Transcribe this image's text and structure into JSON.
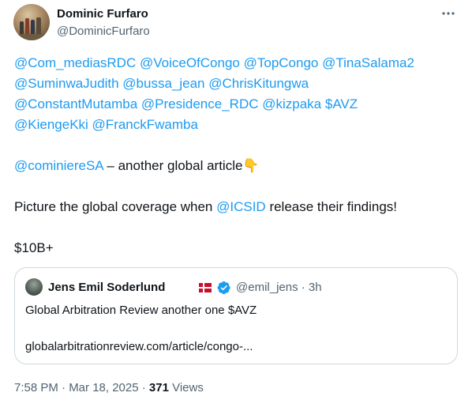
{
  "author": {
    "name": "Dominic Furfaro",
    "handle": "@DominicFurfaro",
    "avatar_icon": "profile-photo"
  },
  "more_icon": "ellipsis-icon",
  "tweet": {
    "mentions_line1": [
      "@Com_mediasRDC",
      "@VoiceOfCongo",
      "@TopCongo",
      "@TinaSalama2"
    ],
    "mentions_line2": [
      "@SuminwaJudith",
      "@bussa_jean",
      "@ChrisKitungwa"
    ],
    "mentions_line3": [
      "@ConstantMutamba",
      "@Presidence_RDC",
      "@kizpaka",
      "$AVZ"
    ],
    "mentions_line4": [
      "@KiengeKki",
      "@FranckFwamba"
    ],
    "line5_mention": "@cominiereSA",
    "line5_text": " – another global article👇",
    "line6_before": "Picture the global coverage when ",
    "line6_mention": "@ICSID",
    "line6_after": " release their findings!",
    "line7": "$10B+"
  },
  "quote": {
    "name": "Jens Emil Soderlund",
    "flag": "Denmark flag",
    "handle_time": "@emil_jens · 3h",
    "text": "Global Arbitration Review another one $AVZ",
    "link": "globalarbitrationreview.com/article/congo-..."
  },
  "meta": {
    "timestamp": "7:58 PM · Mar 18, 2025 · ",
    "views_count": "371",
    "views_label": " Views"
  },
  "colors": {
    "link": "#1d9bf0",
    "secondary_text": "#536471",
    "border": "#cfd9de",
    "verified": "#1d9bf0",
    "flag_red": "#c8102e"
  }
}
